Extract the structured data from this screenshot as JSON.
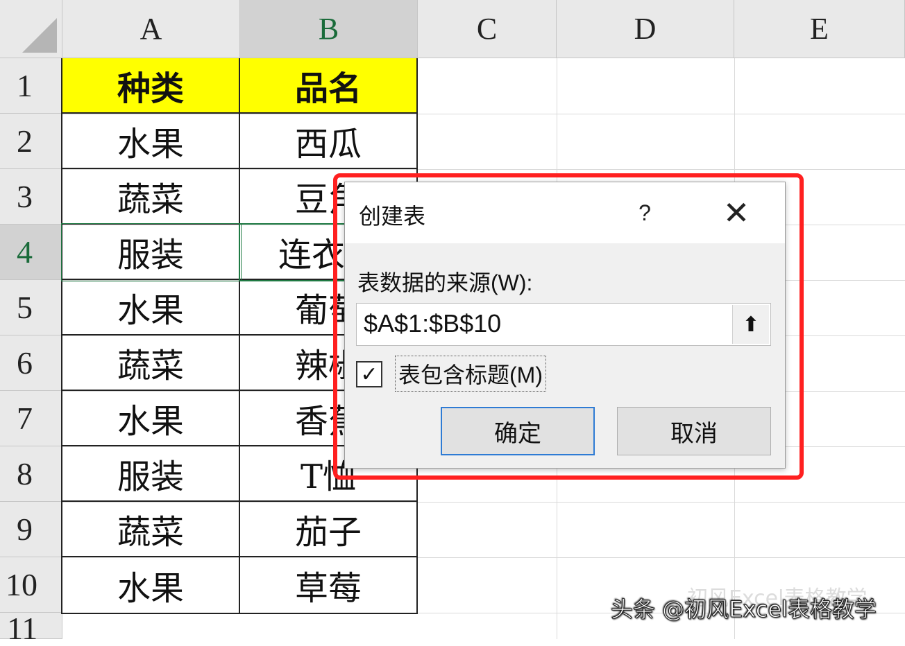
{
  "columns": [
    "A",
    "B",
    "C",
    "D",
    "E"
  ],
  "rows": [
    "1",
    "2",
    "3",
    "4",
    "5",
    "6",
    "7",
    "8",
    "9",
    "10",
    "11"
  ],
  "table": {
    "header": [
      "种类",
      "品名"
    ],
    "body": [
      [
        "水果",
        "西瓜"
      ],
      [
        "蔬菜",
        "豆角"
      ],
      [
        "服装",
        "连衣裙"
      ],
      [
        "水果",
        "葡萄"
      ],
      [
        "蔬菜",
        "辣椒"
      ],
      [
        "水果",
        "香蕉"
      ],
      [
        "服装",
        "T恤"
      ],
      [
        "蔬菜",
        "茄子"
      ],
      [
        "水果",
        "草莓"
      ]
    ],
    "header_fill": "#ffff00"
  },
  "dialog": {
    "title": "创建表",
    "help": "?",
    "close": "✕",
    "source_label": "表数据的来源(W):",
    "range_value": "$A$1:$B$10",
    "collapse_icon": "⬆",
    "has_headers_checked": true,
    "check_mark": "✓",
    "has_headers_label": "表包含标题(M)",
    "ok_label": "确定",
    "cancel_label": "取消",
    "highlight_color": "#ff2020"
  },
  "watermark": {
    "text": "头条 @初风Excel表格教学",
    "ghost": "初风Excel表格教学"
  }
}
